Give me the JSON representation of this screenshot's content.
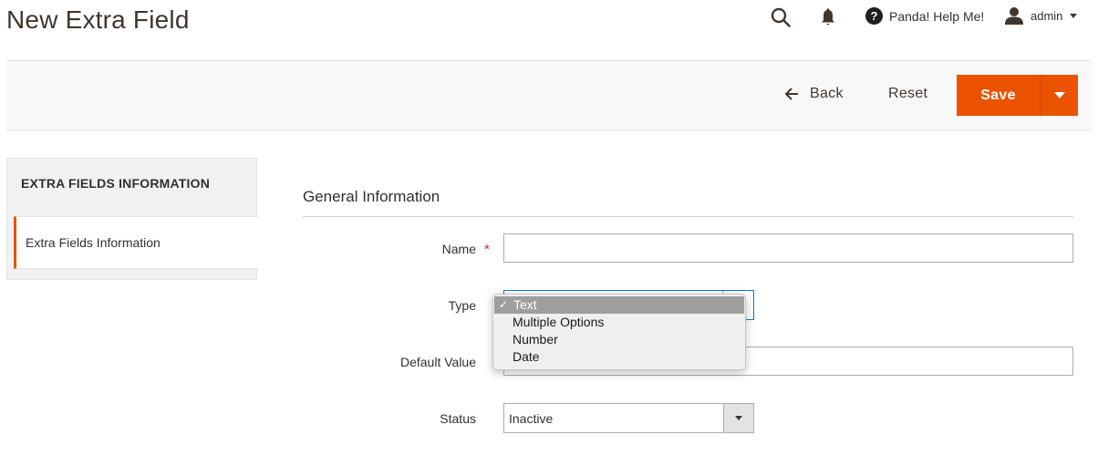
{
  "page": {
    "title": "New Extra Field"
  },
  "header": {
    "search_icon": "search-icon",
    "notifications_icon": "bell-icon",
    "help_label": "Panda! Help Me!",
    "user_label": "admin"
  },
  "actions": {
    "back_label": "Back",
    "reset_label": "Reset",
    "save_label": "Save"
  },
  "sidebar": {
    "title": "EXTRA FIELDS INFORMATION",
    "items": [
      {
        "label": "Extra Fields Information",
        "active": true
      }
    ]
  },
  "form": {
    "section_title": "General Information",
    "fields": {
      "name": {
        "label": "Name",
        "required_mark": "*",
        "value": ""
      },
      "type": {
        "label": "Type",
        "options": [
          "Text",
          "Multiple Options",
          "Number",
          "Date"
        ],
        "selected": "Text",
        "check_mark": "✓"
      },
      "default_value": {
        "label": "Default Value",
        "value": ""
      },
      "status": {
        "label": "Status",
        "value": "Inactive"
      }
    }
  },
  "colors": {
    "accent": "#eb5202",
    "focus_border": "#007bdb",
    "required": "#e22626"
  }
}
